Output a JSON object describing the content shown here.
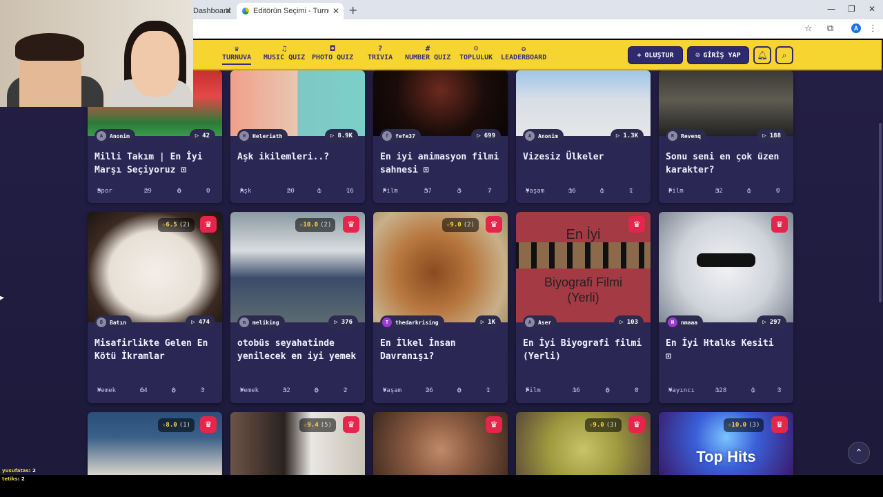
{
  "browser": {
    "tab_inactive": "Dashboard",
    "tab_active": "Editörün Seçimi - Turnuva - Qu",
    "new_tab_symbol": "+"
  },
  "nav": {
    "items": [
      {
        "label": "TURNUVA",
        "icon": "trophy-icon"
      },
      {
        "label": "MUSIC QUIZ",
        "icon": "music-note-icon"
      },
      {
        "label": "PHOTO QUIZ",
        "icon": "camera-icon"
      },
      {
        "label": "TRIVIA",
        "icon": "question-bubble-icon"
      },
      {
        "label": "NUMBER QUIZ",
        "icon": "hash-icon"
      },
      {
        "label": "TOPLULUK",
        "icon": "users-icon"
      },
      {
        "label": "LEADERBOARD",
        "icon": "medal-icon"
      }
    ],
    "create_label": "OLUŞTUR",
    "login_label": "GİRİŞ YAP"
  },
  "cards": [
    {
      "author": "Anonim",
      "plays": "42",
      "title": "Milli Takım | En İyi Marşı Seçiyoruz",
      "video": true,
      "category": "Spor",
      "items": "29",
      "comments": "0",
      "likes": "0"
    },
    {
      "author": "Heleriath",
      "plays": "8.9K",
      "title": "Aşk ikilemleri..?",
      "video": false,
      "category": "Aşk",
      "items": "20",
      "comments": "1",
      "likes": "16"
    },
    {
      "author": "fefe37",
      "plays": "699",
      "title": "En iyi animasyon filmi sahnesi",
      "video": true,
      "category": "Film",
      "items": "57",
      "comments": "3",
      "likes": "7"
    },
    {
      "author": "Anonim",
      "plays": "1.3K",
      "title": "Vizesiz Ülkeler",
      "video": false,
      "category": "Yaşam",
      "items": "16",
      "comments": "1",
      "likes": "1"
    },
    {
      "author": "Revenq",
      "plays": "188",
      "title": "Sonu seni en çok üzen karakter?",
      "video": false,
      "category": "Film",
      "items": "32",
      "comments": "1",
      "likes": "0"
    },
    {
      "author": "Batın",
      "plays": "474",
      "rating": "6.5",
      "rating_count": "(2)",
      "title": "Misafirlikte Gelen En Kötü İkramlar",
      "category": "Yemek",
      "items": "64",
      "comments": "0",
      "likes": "3"
    },
    {
      "author": "meliking",
      "plays": "376",
      "rating": "10.0",
      "rating_count": "(2)",
      "title": "otobüs seyahatinde yenilecek en iyi yemek",
      "category": "Yemek",
      "items": "32",
      "comments": "0",
      "likes": "2"
    },
    {
      "author": "thedarkrising",
      "plays": "1K",
      "rating": "9.0",
      "rating_count": "(2)",
      "title": "En İlkel İnsan Davranışı?",
      "category": "Yaşam",
      "items": "26",
      "comments": "0",
      "likes": "1"
    },
    {
      "author": "Aser",
      "plays": "103",
      "title": "En İyi Biyografi filmi (Yerli)",
      "category": "Film",
      "items": "16",
      "comments": "0",
      "likes": "0",
      "thumb_text": [
        "En İyi",
        "Biyografi Filmi",
        "(Yerli)"
      ]
    },
    {
      "author": "nmaaa",
      "plays": "297",
      "title": "En İyi Htalks Kesiti",
      "video": true,
      "category": "Yayıncı",
      "items": "128",
      "comments": "1",
      "likes": "3"
    },
    {
      "rating": "8.0",
      "rating_count": "(1)"
    },
    {
      "rating": "9.4",
      "rating_count": "(5)"
    },
    {},
    {
      "rating": "9.0",
      "rating_count": "(3)"
    },
    {
      "rating": "10.0",
      "rating_count": "(3)",
      "thumb_text": "Top Hits"
    }
  ],
  "chat": [
    {
      "user": "yusufatas",
      "value": ": 2"
    },
    {
      "user": "tetiks",
      "value": ": 2"
    }
  ]
}
